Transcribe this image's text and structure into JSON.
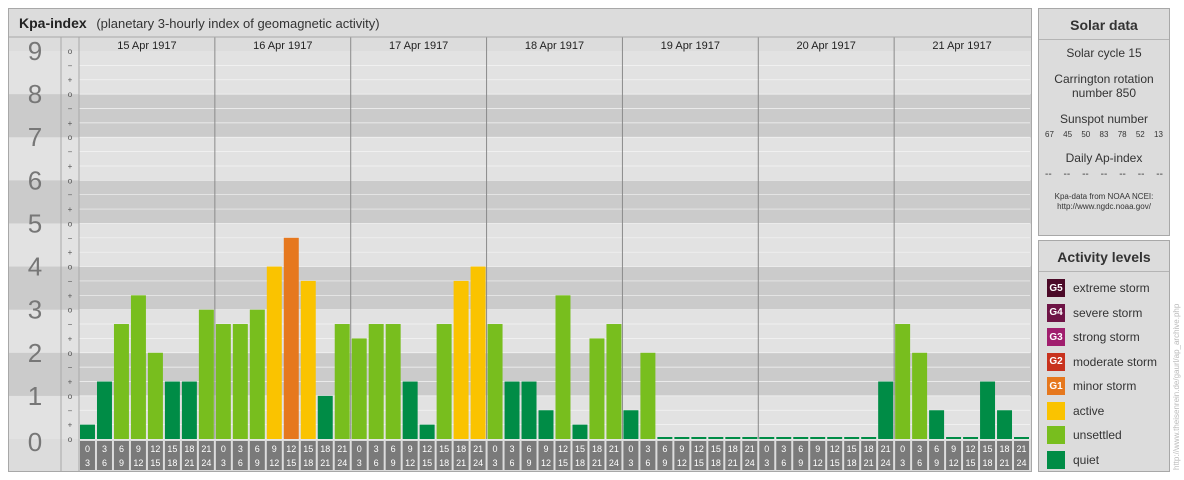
{
  "header": {
    "title": "Kpa-index",
    "subtitle": "(planetary 3-hourly index of geomagnetic activity)"
  },
  "chart_data": {
    "type": "bar",
    "title": "Kpa-index",
    "subtitle": "(planetary 3-hourly index of geomagnetic activity)",
    "ylim": [
      0,
      9
    ],
    "y_ticks": [
      "0",
      "1",
      "2",
      "3",
      "4",
      "5",
      "6",
      "7",
      "8",
      "9"
    ],
    "y_subticks": [
      "+",
      "o",
      "−"
    ],
    "days": [
      "15 Apr 1917",
      "16 Apr 1917",
      "17 Apr 1917",
      "18 Apr 1917",
      "19 Apr 1917",
      "20 Apr 1917",
      "21 Apr 1917"
    ],
    "interval_starts": [
      "0",
      "3",
      "6",
      "9",
      "12",
      "15",
      "18",
      "21"
    ],
    "interval_ends": [
      "3",
      "6",
      "9",
      "12",
      "15",
      "18",
      "21",
      "24"
    ],
    "values": [
      [
        0.333,
        1.333,
        2.667,
        3.333,
        2.0,
        1.333,
        1.333,
        3.0
      ],
      [
        2.667,
        2.667,
        3.0,
        4.0,
        4.667,
        3.667,
        1.0,
        2.667
      ],
      [
        2.333,
        2.667,
        2.667,
        1.333,
        0.333,
        2.667,
        3.667,
        4.0
      ],
      [
        2.667,
        1.333,
        1.333,
        0.667,
        3.333,
        0.333,
        2.333,
        2.667
      ],
      [
        0.667,
        2.0,
        0.0,
        0.0,
        0.0,
        0.0,
        0.0,
        0.0
      ],
      [
        0.0,
        0.0,
        0.0,
        0.0,
        0.0,
        0.0,
        0.0,
        1.333
      ],
      [
        2.667,
        2.0,
        0.667,
        0.0,
        0.0,
        1.333,
        0.667,
        0.0
      ]
    ],
    "grid": true,
    "colors": {
      "quiet": "#008c46",
      "unsettled": "#78be1e",
      "active": "#fac300",
      "minor": "#e6781e",
      "moderate": "#c8321e",
      "strong": "#a01e6e",
      "severe": "#6e1446",
      "extreme": "#4b0a28"
    }
  },
  "solar": {
    "title": "Solar data",
    "solar_cycle": "Solar cycle 15",
    "carrington_line1": "Carrington rotation",
    "carrington_line2": "number 850",
    "sunspot_label": "Sunspot number",
    "sunspot_values": [
      "67",
      "45",
      "50",
      "83",
      "78",
      "52",
      "13"
    ],
    "ap_label": "Daily Ap-index",
    "ap_values": [
      "--",
      "--",
      "--",
      "--",
      "--",
      "--",
      "--"
    ],
    "source_line1": "Kpa-data from NOAA NCEI:",
    "source_line2": "http://www.ngdc.noaa.gov/"
  },
  "legend": {
    "title": "Activity levels",
    "items": [
      {
        "badge": "G5",
        "label": "extreme storm",
        "color": "#4b0a28"
      },
      {
        "badge": "G4",
        "label": "severe storm",
        "color": "#6e1446"
      },
      {
        "badge": "G3",
        "label": "strong storm",
        "color": "#a01e6e"
      },
      {
        "badge": "G2",
        "label": "moderate storm",
        "color": "#c8321e"
      },
      {
        "badge": "G1",
        "label": "minor storm",
        "color": "#e6781e"
      },
      {
        "badge": "",
        "label": "active",
        "color": "#fac300"
      },
      {
        "badge": "",
        "label": "unsettled",
        "color": "#78be1e"
      },
      {
        "badge": "",
        "label": "quiet",
        "color": "#008c46"
      }
    ]
  },
  "watermark": "http://www.theisenrein.de/gaurl/ap_archive.php"
}
